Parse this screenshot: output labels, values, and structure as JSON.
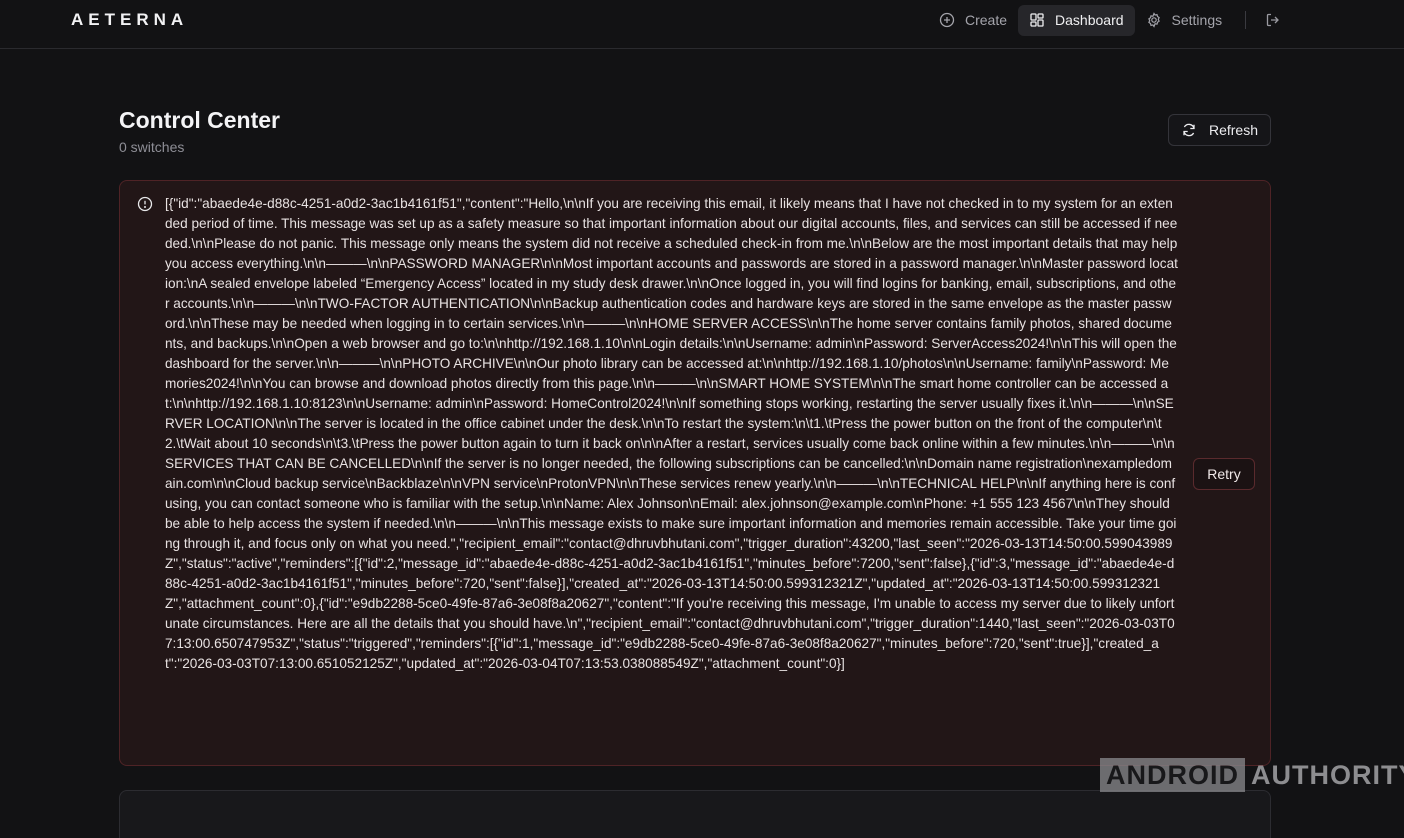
{
  "app": {
    "logo": "AETERNA"
  },
  "nav": {
    "create": "Create",
    "dashboard": "Dashboard",
    "settings": "Settings"
  },
  "page": {
    "title": "Control Center",
    "subtitle": "0 switches",
    "refresh_label": "Refresh"
  },
  "error": {
    "text": "[{\"id\":\"abaede4e-d88c-4251-a0d2-3ac1b4161f51\",\"content\":\"Hello,\\n\\nIf you are receiving this email, it likely means that I have not checked in to my system for an extended period of time. This message was set up as a safety measure so that important information about our digital accounts, files, and services can still be accessed if needed.\\n\\nPlease do not panic. This message only means the system did not receive a scheduled check-in from me.\\n\\nBelow are the most important details that may help you access everything.\\n\\n———\\n\\nPASSWORD MANAGER\\n\\nMost important accounts and passwords are stored in a password manager.\\n\\nMaster password location:\\nA sealed envelope labeled “Emergency Access” located in my study desk drawer.\\n\\nOnce logged in, you will find logins for banking, email, subscriptions, and other accounts.\\n\\n———\\n\\nTWO-FACTOR AUTHENTICATION\\n\\nBackup authentication codes and hardware keys are stored in the same envelope as the master password.\\n\\nThese may be needed when logging in to certain services.\\n\\n———\\n\\nHOME SERVER ACCESS\\n\\nThe home server contains family photos, shared documents, and backups.\\n\\nOpen a web browser and go to:\\n\\nhttp://192.168.1.10\\n\\nLogin details:\\n\\nUsername: admin\\nPassword: ServerAccess2024!\\n\\nThis will open the dashboard for the server.\\n\\n———\\n\\nPHOTO ARCHIVE\\n\\nOur photo library can be accessed at:\\n\\nhttp://192.168.1.10/photos\\n\\nUsername: family\\nPassword: Memories2024!\\n\\nYou can browse and download photos directly from this page.\\n\\n———\\n\\nSMART HOME SYSTEM\\n\\nThe smart home controller can be accessed at:\\n\\nhttp://192.168.1.10:8123\\n\\nUsername: admin\\nPassword: HomeControl2024!\\n\\nIf something stops working, restarting the server usually fixes it.\\n\\n———\\n\\nSERVER LOCATION\\n\\nThe server is located in the office cabinet under the desk.\\n\\nTo restart the system:\\n\\t1.\\tPress the power button on the front of the computer\\n\\t2.\\tWait about 10 seconds\\n\\t3.\\tPress the power button again to turn it back on\\n\\nAfter a restart, services usually come back online within a few minutes.\\n\\n———\\n\\nSERVICES THAT CAN BE CANCELLED\\n\\nIf the server is no longer needed, the following subscriptions can be cancelled:\\n\\nDomain name registration\\nexampledomain.com\\n\\nCloud backup service\\nBackblaze\\n\\nVPN service\\nProtonVPN\\n\\nThese services renew yearly.\\n\\n———\\n\\nTECHNICAL HELP\\n\\nIf anything here is confusing, you can contact someone who is familiar with the setup.\\n\\nName: Alex Johnson\\nEmail: alex.johnson@example.com\\nPhone: +1 555 123 4567\\n\\nThey should be able to help access the system if needed.\\n\\n———\\n\\nThis message exists to make sure important information and memories remain accessible. Take your time going through it, and focus only on what you need.\",\"recipient_email\":\"contact@dhruvbhutani.com\",\"trigger_duration\":43200,\"last_seen\":\"2026-03-13T14:50:00.599043989Z\",\"status\":\"active\",\"reminders\":[{\"id\":2,\"message_id\":\"abaede4e-d88c-4251-a0d2-3ac1b4161f51\",\"minutes_before\":7200,\"sent\":false},{\"id\":3,\"message_id\":\"abaede4e-d88c-4251-a0d2-3ac1b4161f51\",\"minutes_before\":720,\"sent\":false}],\"created_at\":\"2026-03-13T14:50:00.599312321Z\",\"updated_at\":\"2026-03-13T14:50:00.599312321Z\",\"attachment_count\":0},{\"id\":\"e9db2288-5ce0-49fe-87a6-3e08f8a20627\",\"content\":\"If you're receiving this message, I'm unable to access my server due to likely unfortunate circumstances. Here are all the details that you should have.\\n\",\"recipient_email\":\"contact@dhruvbhutani.com\",\"trigger_duration\":1440,\"last_seen\":\"2026-03-03T07:13:00.650747953Z\",\"status\":\"triggered\",\"reminders\":[{\"id\":1,\"message_id\":\"e9db2288-5ce0-49fe-87a6-3e08f8a20627\",\"minutes_before\":720,\"sent\":true}],\"created_at\":\"2026-03-03T07:13:00.651052125Z\",\"updated_at\":\"2026-03-04T07:13:53.038088549Z\",\"attachment_count\":0}]",
    "retry_label": "Retry"
  },
  "watermark": {
    "part1": "ANDROID",
    "part2": "AUTHORITY"
  }
}
